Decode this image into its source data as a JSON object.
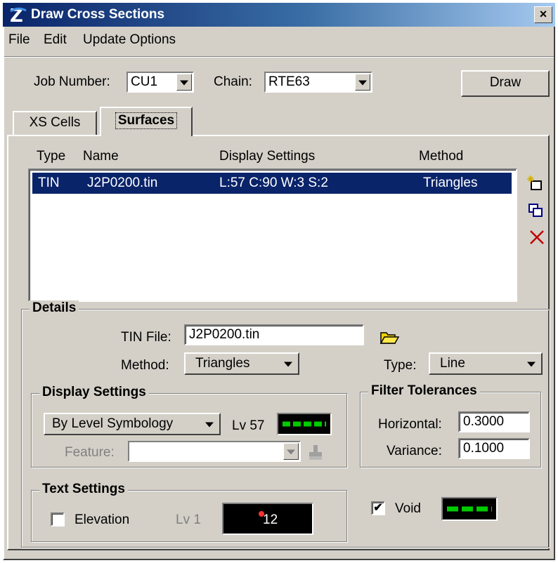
{
  "window": {
    "title": "Draw Cross Sections",
    "close_label": "×"
  },
  "menu": [
    "File",
    "Edit",
    "Update Options"
  ],
  "header": {
    "job_number_label": "Job Number:",
    "job_number_value": "CU1",
    "chain_label": "Chain:",
    "chain_value": "RTE63",
    "draw_button": "Draw"
  },
  "tabs": [
    {
      "label": "XS Cells",
      "active": false
    },
    {
      "label": "Surfaces",
      "active": true
    }
  ],
  "surfaces_list": {
    "columns": [
      "Type",
      "Name",
      "Display Settings",
      "Method"
    ],
    "rows": [
      {
        "type": "TIN",
        "name": "J2P0200.tin",
        "display": "L:57 C:90 W:3 S:2",
        "method": "Triangles",
        "selected": true
      }
    ],
    "icons": [
      "add-surface-icon",
      "copy-surface-icon",
      "delete-surface-icon"
    ]
  },
  "details": {
    "title": "Details",
    "tin_file_label": "TIN File:",
    "tin_file_value": "J2P0200.tin",
    "method_label": "Method:",
    "method_value": "Triangles",
    "type_label": "Type:",
    "type_value": "Line"
  },
  "display_settings": {
    "title": "Display Settings",
    "symbology_value": "By Level Symbology",
    "level_label": "Lv 57",
    "feature_label": "Feature:",
    "feature_value": ""
  },
  "filter_tolerances": {
    "title": "Filter Tolerances",
    "horizontal_label": "Horizontal:",
    "horizontal_value": "0.3000",
    "variance_label": "Variance:",
    "variance_value": "0.1000"
  },
  "text_settings": {
    "title": "Text Settings",
    "elevation_label": "Elevation",
    "elevation_checked": false,
    "level_label": "Lv 1",
    "preview_text": "12"
  },
  "void": {
    "label": "Void",
    "checked": true,
    "check_mark": "✔"
  },
  "colors": {
    "selection": "#0a246a",
    "line_green": "#00cc00",
    "delete_red": "#c00000",
    "folder_yellow": "#f0d000",
    "dialog_face": "#d4d0c8"
  }
}
